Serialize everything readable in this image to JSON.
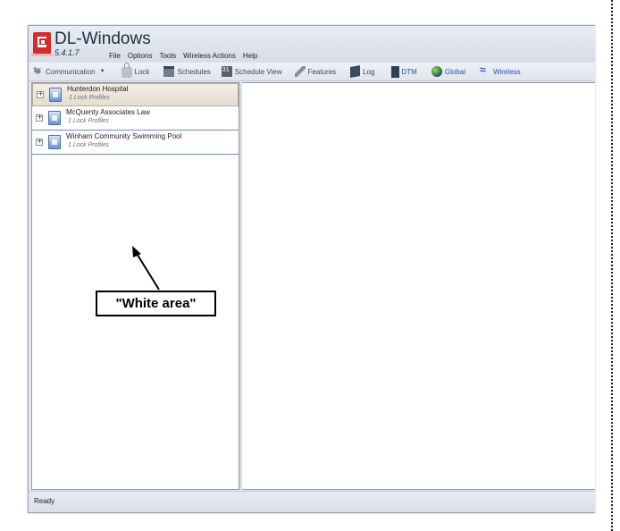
{
  "app": {
    "title": "DL-Windows",
    "version": "5.4.1.7"
  },
  "menu": [
    "File",
    "Options",
    "Tools",
    "Wireless Actions",
    "Help"
  ],
  "toolbar": {
    "communication": "Communication",
    "lock": "Lock",
    "schedules": "Schedules",
    "schedule_view": "Schedule View",
    "features": "Features",
    "log": "Log",
    "dtm": "DTM",
    "global": "Global",
    "wireless": "Wireless"
  },
  "tree": [
    {
      "name": "Hunterdon Hospital",
      "sub": "1 Lock Profiles"
    },
    {
      "name": "McQuenty Associates Law",
      "sub": "1 Lock Profiles"
    },
    {
      "name": "Winham Community Swimming Pool",
      "sub": "1 Lock Profiles"
    }
  ],
  "status": "Ready",
  "annotation": "\"White area\"",
  "colors": {
    "accent_red": "#d62b2b",
    "selection": "#e5ddd1",
    "tree_border": "#6c8ec0"
  }
}
